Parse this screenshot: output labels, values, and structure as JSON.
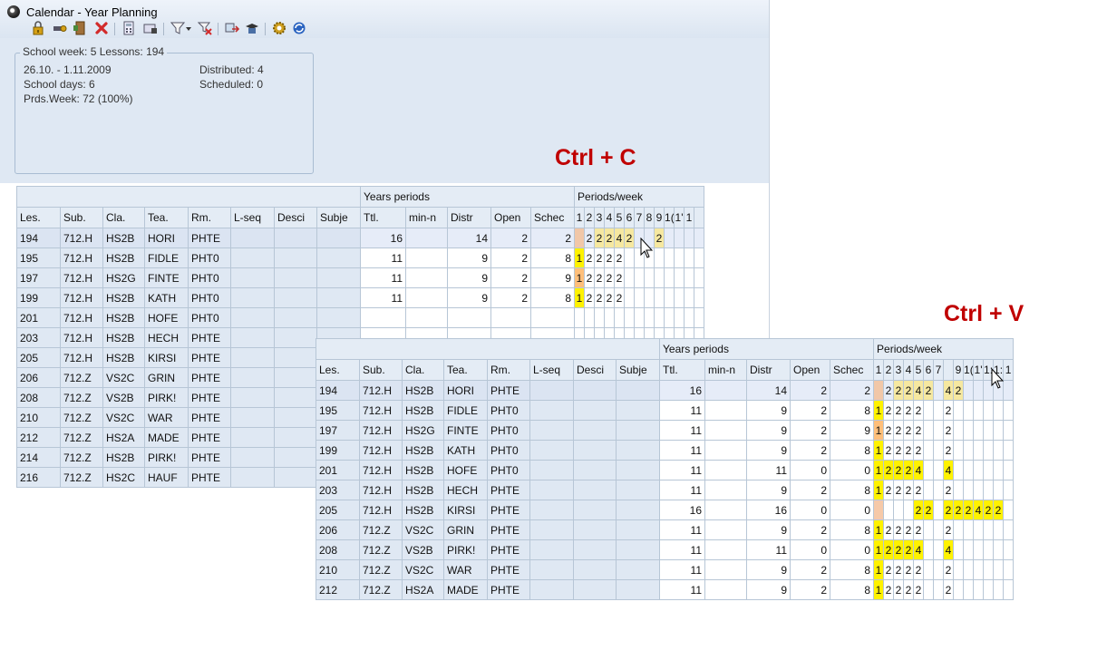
{
  "window": {
    "title": "Calendar - Year Planning"
  },
  "toolbar": {
    "icons": [
      "lock-icon",
      "key-icon",
      "door-icon",
      "delete-icon",
      "calculator-icon",
      "card-icon",
      "filter-icon",
      "filter-dropdown-icon",
      "filter-clear-icon",
      "transfer-icon",
      "grad-cap-icon",
      "settings-icon",
      "refresh-icon"
    ],
    "colors": {
      "lock": "#d4a017",
      "delete": "#d22a2a",
      "gear": "#d0a020",
      "refresh": "#2a63c0"
    }
  },
  "info": {
    "legend": "School week: 5  Lessons: 194",
    "date_range": "26.10. - 1.11.2009",
    "school_days": "School days: 6",
    "prds_week": "Prds.Week: 72 (100%)",
    "distributed": "Distributed: 4",
    "scheduled": "Scheduled: 0"
  },
  "annotations": {
    "copy": "Ctrl + C",
    "paste": "Ctrl + V",
    "color": "#c00000"
  },
  "colors": {
    "yellow": "#fff200",
    "orange": "#ffbf7a",
    "peach": "#f6c9a8"
  },
  "grid1": {
    "group_years": "Years periods",
    "group_week": "Periods/week",
    "columns": [
      "Les.",
      "Sub.",
      "Cla.",
      "Tea.",
      "Rm.",
      "L-seq",
      "Desci",
      "Subje",
      "Ttl.",
      "min-n",
      "Distr",
      "Open",
      "Schec"
    ],
    "period_labels": [
      "1",
      "2",
      "3",
      "4",
      "5",
      "6",
      "7",
      "8",
      "9",
      "1(",
      "1'",
      "1"
    ],
    "rows": [
      {
        "les": "194",
        "sub": "712.H",
        "cla": "HS2B",
        "tea": "HORI",
        "rm": "PHTE",
        "ttl": "16",
        "distr": "14",
        "open": "2",
        "sched": "2",
        "p": [
          [
            "",
            "p"
          ],
          [
            "2",
            ""
          ],
          [
            "2",
            "yo"
          ],
          [
            "2",
            "yo"
          ],
          [
            "4",
            "yo"
          ],
          [
            "2",
            "yo"
          ],
          [
            "",
            ""
          ],
          [
            "",
            ""
          ],
          [
            "2",
            "yo"
          ],
          [
            "",
            ""
          ],
          [
            "",
            ""
          ],
          [
            "",
            ""
          ]
        ]
      },
      {
        "les": "195",
        "sub": "712.H",
        "cla": "HS2B",
        "tea": "FIDLE",
        "rm": "PHT0",
        "ttl": "11",
        "distr": "9",
        "open": "2",
        "sched": "8",
        "p": [
          [
            "1",
            "y"
          ],
          [
            "2",
            ""
          ],
          [
            "2",
            ""
          ],
          [
            "2",
            ""
          ],
          [
            "2",
            ""
          ],
          [
            "",
            ""
          ],
          [
            "",
            ""
          ],
          [
            "",
            ""
          ],
          [
            "",
            ""
          ],
          [
            "",
            ""
          ],
          [
            "",
            ""
          ],
          [
            "",
            ""
          ]
        ]
      },
      {
        "les": "197",
        "sub": "712.H",
        "cla": "HS2G",
        "tea": "FINTE",
        "rm": "PHT0",
        "ttl": "11",
        "distr": "9",
        "open": "2",
        "sched": "9",
        "p": [
          [
            "1",
            "o"
          ],
          [
            "2",
            ""
          ],
          [
            "2",
            ""
          ],
          [
            "2",
            ""
          ],
          [
            "2",
            ""
          ],
          [
            "",
            ""
          ],
          [
            "",
            ""
          ],
          [
            "",
            ""
          ],
          [
            "",
            ""
          ],
          [
            "",
            ""
          ],
          [
            "",
            ""
          ],
          [
            "",
            ""
          ]
        ]
      },
      {
        "les": "199",
        "sub": "712.H",
        "cla": "HS2B",
        "tea": "KATH",
        "rm": "PHT0",
        "ttl": "11",
        "distr": "9",
        "open": "2",
        "sched": "8",
        "p": [
          [
            "1",
            "y"
          ],
          [
            "2",
            ""
          ],
          [
            "2",
            ""
          ],
          [
            "2",
            ""
          ],
          [
            "2",
            ""
          ],
          [
            "",
            ""
          ],
          [
            "",
            ""
          ],
          [
            "",
            ""
          ],
          [
            "",
            ""
          ],
          [
            "",
            ""
          ],
          [
            "",
            ""
          ],
          [
            "",
            ""
          ]
        ]
      },
      {
        "les": "201",
        "sub": "712.H",
        "cla": "HS2B",
        "tea": "HOFE",
        "rm": "PHT0"
      },
      {
        "les": "203",
        "sub": "712.H",
        "cla": "HS2B",
        "tea": "HECH",
        "rm": "PHTE"
      },
      {
        "les": "205",
        "sub": "712.H",
        "cla": "HS2B",
        "tea": "KIRSI",
        "rm": "PHTE"
      },
      {
        "les": "206",
        "sub": "712.Z",
        "cla": "VS2C",
        "tea": "GRIN",
        "rm": "PHTE"
      },
      {
        "les": "208",
        "sub": "712.Z",
        "cla": "VS2B",
        "tea": "PIRK!",
        "rm": "PHTE"
      },
      {
        "les": "210",
        "sub": "712.Z",
        "cla": "VS2C",
        "tea": "WAR",
        "rm": "PHTE"
      },
      {
        "les": "212",
        "sub": "712.Z",
        "cla": "HS2A",
        "tea": "MADE",
        "rm": "PHTE"
      },
      {
        "les": "214",
        "sub": "712.Z",
        "cla": "HS2B",
        "tea": "PIRK!",
        "rm": "PHTE"
      },
      {
        "les": "216",
        "sub": "712.Z",
        "cla": "HS2C",
        "tea": "HAUF",
        "rm": "PHTE"
      }
    ]
  },
  "grid2": {
    "group_years": "Years periods",
    "group_week": "Periods/week",
    "columns": [
      "Les.",
      "Sub.",
      "Cla.",
      "Tea.",
      "Rm.",
      "L-seq",
      "Desci",
      "Subje",
      "Ttl.",
      "min-n",
      "Distr",
      "Open",
      "Schec"
    ],
    "period_labels": [
      "1",
      "2",
      "3",
      "4",
      "5",
      "6",
      "7",
      "",
      "9",
      "1(",
      "1'",
      "1:",
      "1:",
      "1"
    ],
    "rows": [
      {
        "les": "194",
        "sub": "712.H",
        "cla": "HS2B",
        "tea": "HORI",
        "rm": "PHTE",
        "ttl": "16",
        "distr": "14",
        "open": "2",
        "sched": "2",
        "p": [
          [
            "",
            "p"
          ],
          [
            "2",
            ""
          ],
          [
            "2",
            "yo"
          ],
          [
            "2",
            "yo"
          ],
          [
            "4",
            "yo"
          ],
          [
            "2",
            "yo"
          ],
          [
            "",
            ""
          ],
          [
            "4",
            "yo"
          ],
          [
            "2",
            "yo"
          ],
          [
            "",
            ""
          ],
          [
            "",
            ""
          ],
          [
            "",
            ""
          ],
          [
            "",
            ""
          ],
          [
            "",
            ""
          ]
        ]
      },
      {
        "les": "195",
        "sub": "712.H",
        "cla": "HS2B",
        "tea": "FIDLE",
        "rm": "PHT0",
        "ttl": "11",
        "distr": "9",
        "open": "2",
        "sched": "8",
        "p": [
          [
            "1",
            "y"
          ],
          [
            "2",
            ""
          ],
          [
            "2",
            ""
          ],
          [
            "2",
            ""
          ],
          [
            "2",
            ""
          ],
          [
            "",
            ""
          ],
          [
            "",
            ""
          ],
          [
            "2",
            ""
          ],
          [
            "",
            ""
          ],
          [
            "",
            ""
          ],
          [
            "",
            ""
          ],
          [
            "",
            ""
          ],
          [
            "",
            ""
          ],
          [
            "",
            ""
          ]
        ]
      },
      {
        "les": "197",
        "sub": "712.H",
        "cla": "HS2G",
        "tea": "FINTE",
        "rm": "PHT0",
        "ttl": "11",
        "distr": "9",
        "open": "2",
        "sched": "9",
        "p": [
          [
            "1",
            "o"
          ],
          [
            "2",
            ""
          ],
          [
            "2",
            ""
          ],
          [
            "2",
            ""
          ],
          [
            "2",
            ""
          ],
          [
            "",
            ""
          ],
          [
            "",
            ""
          ],
          [
            "2",
            ""
          ],
          [
            "",
            ""
          ],
          [
            "",
            ""
          ],
          [
            "",
            ""
          ],
          [
            "",
            ""
          ],
          [
            "",
            ""
          ],
          [
            "",
            ""
          ]
        ]
      },
      {
        "les": "199",
        "sub": "712.H",
        "cla": "HS2B",
        "tea": "KATH",
        "rm": "PHT0",
        "ttl": "11",
        "distr": "9",
        "open": "2",
        "sched": "8",
        "p": [
          [
            "1",
            "y"
          ],
          [
            "2",
            ""
          ],
          [
            "2",
            ""
          ],
          [
            "2",
            ""
          ],
          [
            "2",
            ""
          ],
          [
            "",
            ""
          ],
          [
            "",
            ""
          ],
          [
            "2",
            ""
          ],
          [
            "",
            ""
          ],
          [
            "",
            ""
          ],
          [
            "",
            ""
          ],
          [
            "",
            ""
          ],
          [
            "",
            ""
          ],
          [
            "",
            ""
          ]
        ]
      },
      {
        "les": "201",
        "sub": "712.H",
        "cla": "HS2B",
        "tea": "HOFE",
        "rm": "PHT0",
        "ttl": "11",
        "distr": "11",
        "open": "0",
        "sched": "0",
        "p": [
          [
            "1",
            "y"
          ],
          [
            "2",
            "y"
          ],
          [
            "2",
            "y"
          ],
          [
            "2",
            "y"
          ],
          [
            "4",
            "y"
          ],
          [
            "",
            ""
          ],
          [
            "",
            ""
          ],
          [
            "4",
            "y"
          ],
          [
            "",
            ""
          ],
          [
            "",
            ""
          ],
          [
            "",
            ""
          ],
          [
            "",
            ""
          ],
          [
            "",
            ""
          ],
          [
            "",
            ""
          ]
        ]
      },
      {
        "les": "203",
        "sub": "712.H",
        "cla": "HS2B",
        "tea": "HECH",
        "rm": "PHTE",
        "ttl": "11",
        "distr": "9",
        "open": "2",
        "sched": "8",
        "p": [
          [
            "1",
            "y"
          ],
          [
            "2",
            ""
          ],
          [
            "2",
            ""
          ],
          [
            "2",
            ""
          ],
          [
            "2",
            ""
          ],
          [
            "",
            ""
          ],
          [
            "",
            ""
          ],
          [
            "2",
            ""
          ],
          [
            "",
            ""
          ],
          [
            "",
            ""
          ],
          [
            "",
            ""
          ],
          [
            "",
            ""
          ],
          [
            "",
            ""
          ],
          [
            "",
            ""
          ]
        ]
      },
      {
        "les": "205",
        "sub": "712.H",
        "cla": "HS2B",
        "tea": "KIRSI",
        "rm": "PHTE",
        "ttl": "16",
        "distr": "16",
        "open": "0",
        "sched": "0",
        "p": [
          [
            "",
            "p"
          ],
          [
            "",
            ""
          ],
          [
            "",
            ""
          ],
          [
            "",
            ""
          ],
          [
            "2",
            "y"
          ],
          [
            "2",
            "y"
          ],
          [
            "",
            ""
          ],
          [
            "2",
            "y"
          ],
          [
            "2",
            "y"
          ],
          [
            "2",
            "y"
          ],
          [
            "4",
            "y"
          ],
          [
            "2",
            "y"
          ],
          [
            "2",
            "y"
          ],
          [
            "",
            ""
          ]
        ]
      },
      {
        "les": "206",
        "sub": "712.Z",
        "cla": "VS2C",
        "tea": "GRIN",
        "rm": "PHTE",
        "ttl": "11",
        "distr": "9",
        "open": "2",
        "sched": "8",
        "p": [
          [
            "1",
            "y"
          ],
          [
            "2",
            ""
          ],
          [
            "2",
            ""
          ],
          [
            "2",
            ""
          ],
          [
            "2",
            ""
          ],
          [
            "",
            ""
          ],
          [
            "",
            ""
          ],
          [
            "2",
            ""
          ],
          [
            "",
            ""
          ],
          [
            "",
            ""
          ],
          [
            "",
            ""
          ],
          [
            "",
            ""
          ],
          [
            "",
            ""
          ],
          [
            "",
            ""
          ]
        ]
      },
      {
        "les": "208",
        "sub": "712.Z",
        "cla": "VS2B",
        "tea": "PIRK!",
        "rm": "PHTE",
        "ttl": "11",
        "distr": "11",
        "open": "0",
        "sched": "0",
        "p": [
          [
            "1",
            "y"
          ],
          [
            "2",
            "y"
          ],
          [
            "2",
            "y"
          ],
          [
            "2",
            "y"
          ],
          [
            "4",
            "y"
          ],
          [
            "",
            ""
          ],
          [
            "",
            ""
          ],
          [
            "4",
            "y"
          ],
          [
            "",
            ""
          ],
          [
            "",
            ""
          ],
          [
            "",
            ""
          ],
          [
            "",
            ""
          ],
          [
            "",
            ""
          ],
          [
            "",
            ""
          ]
        ]
      },
      {
        "les": "210",
        "sub": "712.Z",
        "cla": "VS2C",
        "tea": "WAR",
        "rm": "PHTE",
        "ttl": "11",
        "distr": "9",
        "open": "2",
        "sched": "8",
        "p": [
          [
            "1",
            "y"
          ],
          [
            "2",
            ""
          ],
          [
            "2",
            ""
          ],
          [
            "2",
            ""
          ],
          [
            "2",
            ""
          ],
          [
            "",
            ""
          ],
          [
            "",
            ""
          ],
          [
            "2",
            ""
          ],
          [
            "",
            ""
          ],
          [
            "",
            ""
          ],
          [
            "",
            ""
          ],
          [
            "",
            ""
          ],
          [
            "",
            ""
          ],
          [
            "",
            ""
          ]
        ]
      },
      {
        "les": "212",
        "sub": "712.Z",
        "cla": "HS2A",
        "tea": "MADE",
        "rm": "PHTE",
        "ttl": "11",
        "distr": "9",
        "open": "2",
        "sched": "8",
        "p": [
          [
            "1",
            "y"
          ],
          [
            "2",
            ""
          ],
          [
            "2",
            ""
          ],
          [
            "2",
            ""
          ],
          [
            "2",
            ""
          ],
          [
            "",
            ""
          ],
          [
            "",
            ""
          ],
          [
            "2",
            ""
          ],
          [
            "",
            ""
          ],
          [
            "",
            ""
          ],
          [
            "",
            ""
          ],
          [
            "",
            ""
          ],
          [
            "",
            ""
          ],
          [
            "",
            ""
          ]
        ]
      }
    ]
  }
}
